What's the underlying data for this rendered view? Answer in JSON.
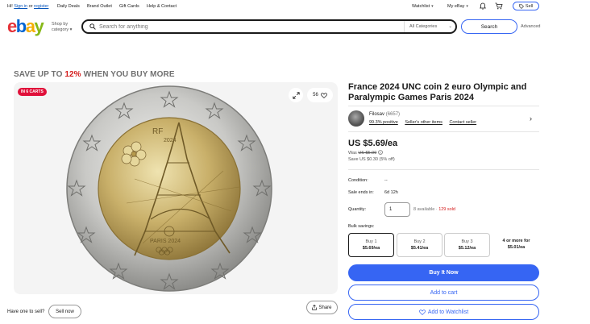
{
  "topbar": {
    "greeting_prefix": "Hi!",
    "sign_in": "Sign in",
    "or": "or",
    "register": "register",
    "links": [
      "Daily Deals",
      "Brand Outlet",
      "Gift Cards",
      "Help & Contact"
    ],
    "watchlist": "Watchlist",
    "my_ebay": "My eBay",
    "sell": "Sell"
  },
  "header": {
    "shop_by": "Shop by",
    "category": "category",
    "search_placeholder": "Search for anything",
    "all_categories": "All Categories",
    "search_button": "Search",
    "advanced": "Advanced"
  },
  "promo": {
    "prefix": "SAVE UP TO",
    "percent": "12%",
    "suffix": "WHEN YOU BUY MORE"
  },
  "gallery": {
    "cart_badge": "IN 6 CARTS",
    "watch_count": "56",
    "coin_year": "2024",
    "coin_text": "PARIS 2024",
    "coin_country": "RF"
  },
  "sell_prompt": {
    "question": "Have one to sell?",
    "button": "Sell now"
  },
  "share": "Share",
  "item": {
    "title": "France 2024 UNC coin 2 euro Olympic and Paralympic Games Paris 2024",
    "seller": {
      "name": "Filosav",
      "feedback_count": "(6657)",
      "positive": "99.3% positive",
      "other_items": "Seller's other items",
      "contact": "Contact seller"
    },
    "price": "US $5.69/ea",
    "was_label": "Was",
    "was_price": "US $5.99",
    "save": "Save US $0.30 (5% off)",
    "condition_label": "Condition:",
    "condition_value": "--",
    "sale_ends_label": "Sale ends in:",
    "sale_ends_value": "6d 12h",
    "quantity_label": "Quantity:",
    "quantity_value": "1",
    "available": "8 available",
    "sold": "129 sold",
    "bulk_label": "Bulk savings:",
    "bulk": [
      {
        "qty": "Buy 1",
        "price": "$5.69/ea"
      },
      {
        "qty": "Buy 2",
        "price": "$5.41/ea"
      },
      {
        "qty": "Buy 3",
        "price": "$5.12/ea"
      },
      {
        "qty": "4 or more for",
        "price": "$5.01/ea"
      }
    ],
    "buy_now": "Buy It Now",
    "add_to_cart": "Add to cart",
    "add_to_watchlist": "Add to Watchlist"
  },
  "colors": {
    "primary_blue": "#3665f3",
    "badge_red": "#e0103a",
    "sold_red": "#d41a1a"
  }
}
